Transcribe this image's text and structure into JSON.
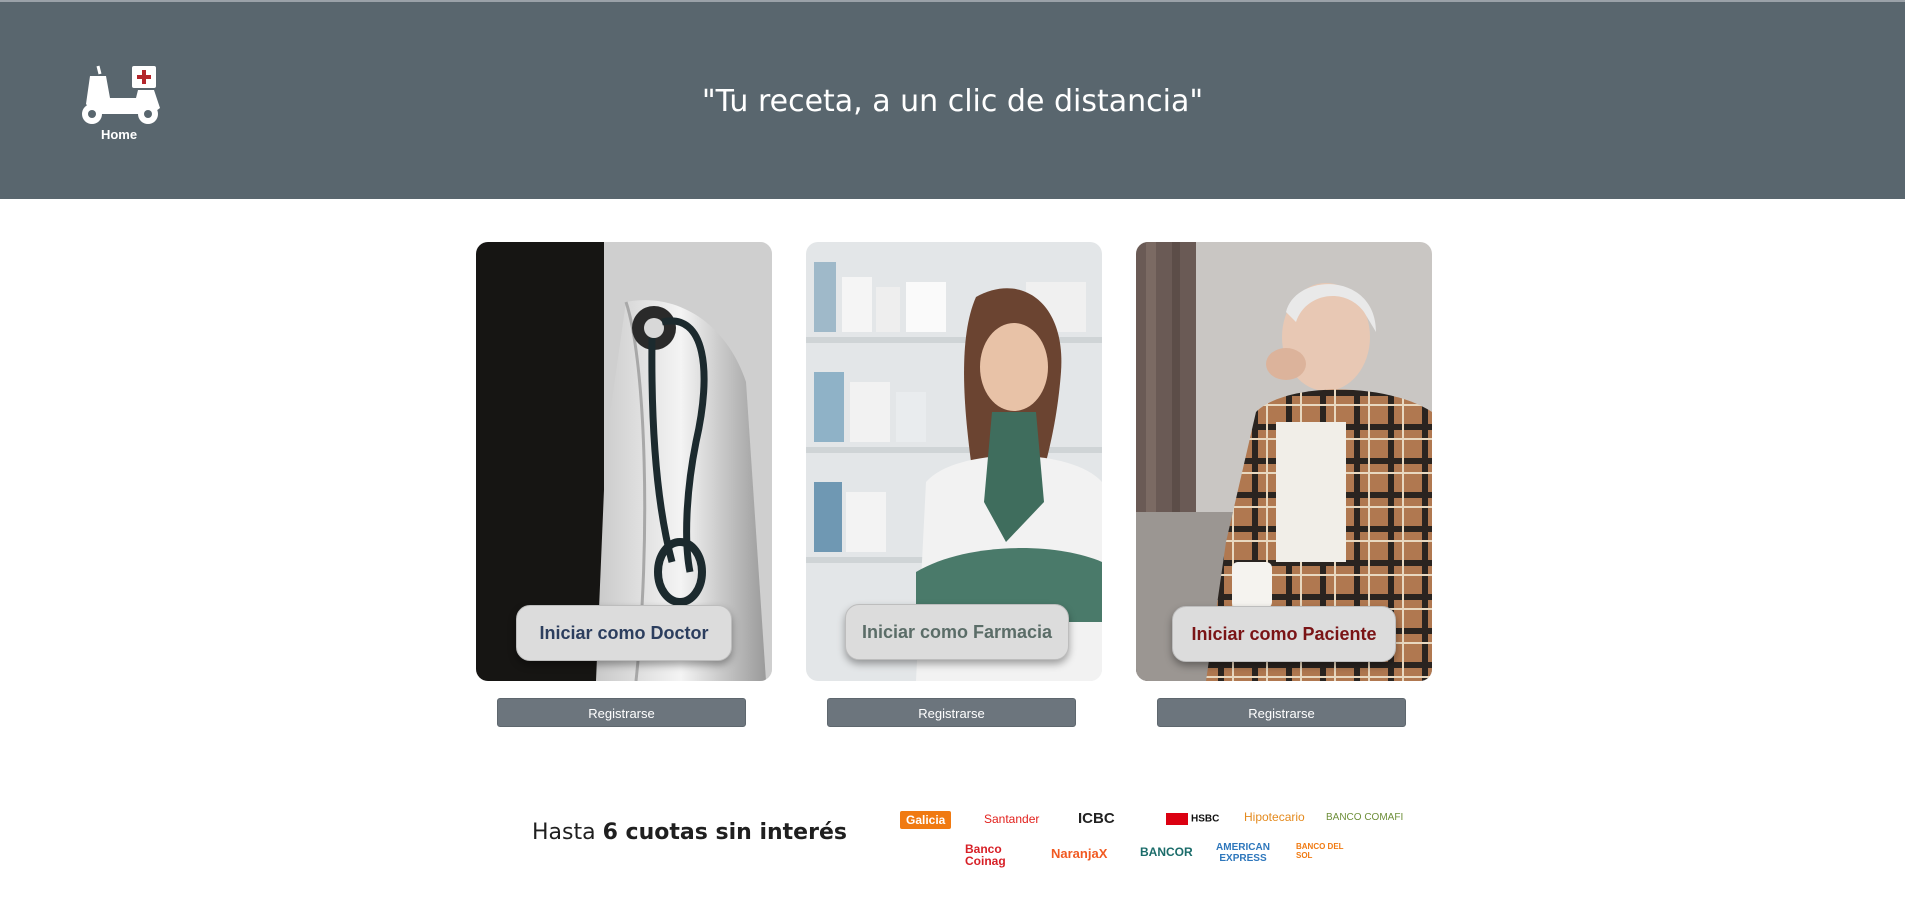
{
  "header": {
    "logo_label": "Home",
    "tagline": "\"Tu receta, a un clic de distancia\""
  },
  "cards": [
    {
      "button_label": "Iniciar como Doctor",
      "register_label": "Registrarse"
    },
    {
      "button_label": "Iniciar como Farmacia",
      "register_label": "Registrarse"
    },
    {
      "button_label": "Iniciar como Paciente",
      "register_label": "Registrarse"
    }
  ],
  "promo": {
    "prefix": "Hasta",
    "emphasis": "6 cuotas sin interés"
  },
  "banks": {
    "galicia": "Galicia",
    "santander": "Santander",
    "icbc": "ICBC",
    "hsbc": "HSBC",
    "hipotecario": "Hipotecario",
    "comafi": "BANCO COMAFI",
    "coinag": "Banco Coinag",
    "naranjax": "NaranjaX",
    "bancor": "BANCOR",
    "amex": "AMERICAN EXPRESS",
    "bancodelsol": "BANCO DEL SOL"
  },
  "colors": {
    "header_bg": "#59666e",
    "register_bg": "#6c757d",
    "doctor_text": "#2c3e5e",
    "farmacia_text": "#5b6d68",
    "paciente_text": "#7a1416"
  }
}
